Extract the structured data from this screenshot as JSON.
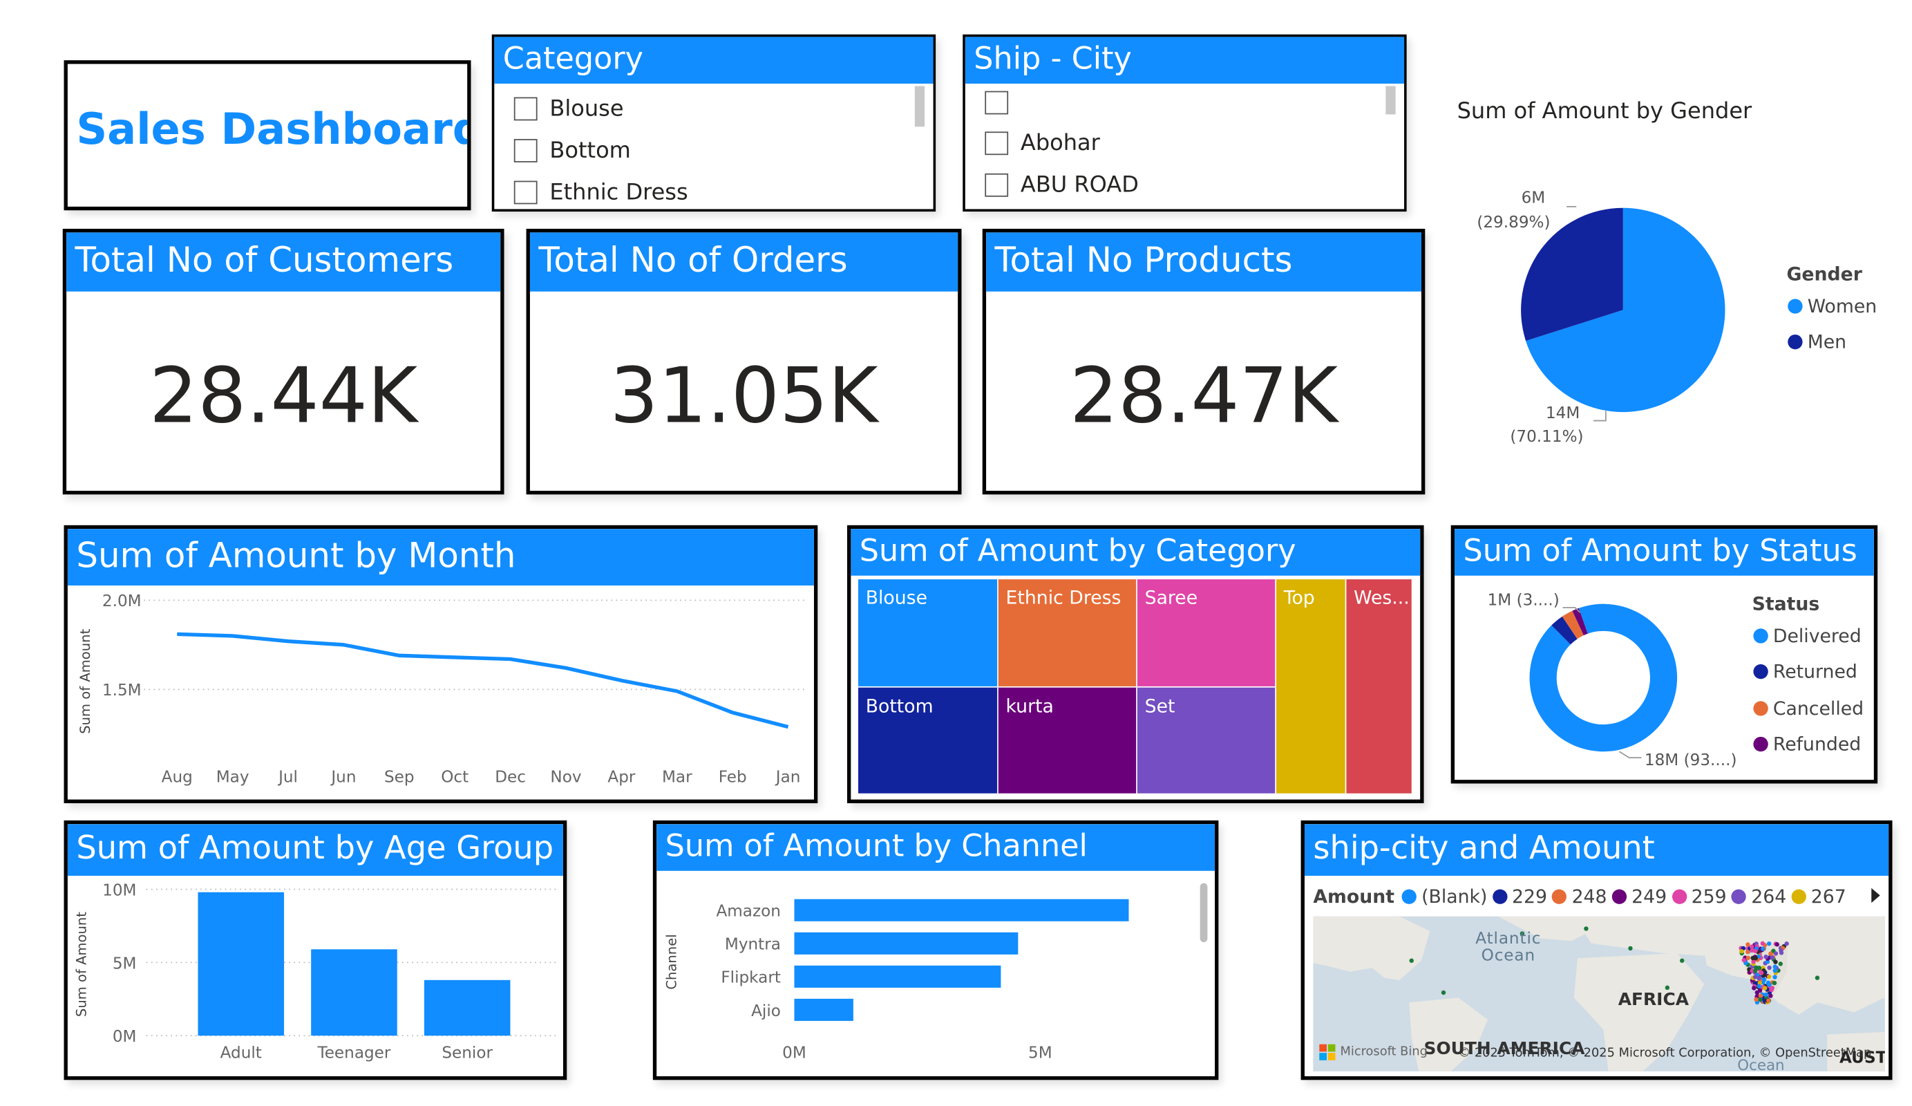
{
  "title": "Sales Dashboard",
  "slicers": {
    "category": {
      "title": "Category",
      "items": [
        "Blouse",
        "Bottom",
        "Ethnic Dress"
      ]
    },
    "ship_city": {
      "title": "Ship - City",
      "items": [
        "",
        "Abohar",
        "ABU ROAD"
      ]
    }
  },
  "kpis": [
    {
      "title": "Total No of Customers",
      "value": "28.44K"
    },
    {
      "title": "Total No of Orders",
      "value": "31.05K"
    },
    {
      "title": "Total No Products",
      "value": "28.47K"
    }
  ],
  "colors": {
    "primary": "#118DFF",
    "navy": "#12239E",
    "orange": "#E66C37",
    "purple": "#6B007B",
    "pink": "#E044A7",
    "violet": "#744EC2",
    "yellow": "#D9B300",
    "red": "#D64550"
  },
  "chart_data": [
    {
      "type": "pie",
      "title": "Sum of Amount by Gender",
      "legend_title": "Gender",
      "legend_position": "right",
      "slices": [
        {
          "label": "Women",
          "value": 14,
          "percent": 70.11,
          "value_label": "14M",
          "percent_label": "(70.11%)",
          "color": "#118DFF"
        },
        {
          "label": "Men",
          "value": 6,
          "percent": 29.89,
          "value_label": "6M",
          "percent_label": "(29.89%)",
          "color": "#12239E"
        }
      ]
    },
    {
      "type": "line",
      "title": "Sum of Amount by Month",
      "ylabel": "Sum of Amount",
      "xlabel": "",
      "categories": [
        "Aug",
        "May",
        "Jul",
        "Jun",
        "Sep",
        "Oct",
        "Dec",
        "Nov",
        "Apr",
        "Mar",
        "Feb",
        "Jan"
      ],
      "values": [
        1.81,
        1.8,
        1.77,
        1.75,
        1.69,
        1.68,
        1.67,
        1.62,
        1.55,
        1.49,
        1.37,
        1.29
      ],
      "unit_multiplier": 1000000,
      "ylim": [
        1.2,
        2.0
      ],
      "yticks": [
        1.5,
        2.0
      ],
      "ytick_labels": [
        "1.5M",
        "2.0M"
      ],
      "grid": true,
      "color": "#118DFF"
    },
    {
      "type": "treemap",
      "title": "Sum of Amount by Category",
      "cells": [
        {
          "label": "Blouse",
          "color": "#118DFF"
        },
        {
          "label": "Ethnic Dress",
          "color": "#E66C37"
        },
        {
          "label": "Saree",
          "color": "#E044A7"
        },
        {
          "label": "Top",
          "color": "#D9B300"
        },
        {
          "label": "Wes...",
          "color": "#D64550"
        },
        {
          "label": "Bottom",
          "color": "#12239E"
        },
        {
          "label": "kurta",
          "color": "#6B007B"
        },
        {
          "label": "Set",
          "color": "#744EC2"
        }
      ]
    },
    {
      "type": "donut",
      "title": "Sum of Amount by Status",
      "legend_title": "Status",
      "legend_position": "right",
      "slices": [
        {
          "label": "Delivered",
          "percent": 93,
          "color": "#118DFF"
        },
        {
          "label": "Returned",
          "percent": 3,
          "color": "#12239E"
        },
        {
          "label": "Cancelled",
          "percent": 2.5,
          "color": "#E66C37"
        },
        {
          "label": "Refunded",
          "percent": 1.5,
          "color": "#6B007B"
        }
      ],
      "data_labels": [
        "18M (93....)",
        "1M (3....)"
      ]
    },
    {
      "type": "bar",
      "title": "Sum of Amount by Age Group",
      "ylabel": "Sum of Amount",
      "xlabel": "",
      "categories": [
        "Adult",
        "Teenager",
        "Senior"
      ],
      "values": [
        9.8,
        5.9,
        3.8
      ],
      "unit_multiplier": 1000000,
      "ylim": [
        0,
        10
      ],
      "yticks": [
        0,
        5,
        10
      ],
      "ytick_labels": [
        "0M",
        "5M",
        "10M"
      ],
      "grid": true,
      "color": "#118DFF"
    },
    {
      "type": "bar",
      "orientation": "horizontal",
      "title": "Sum of Amount by Channel",
      "ylabel": "Channel",
      "xlabel": "",
      "categories": [
        "Amazon",
        "Myntra",
        "Flipkart",
        "Ajio"
      ],
      "values": [
        6.8,
        4.55,
        4.2,
        1.2
      ],
      "unit_multiplier": 1000000,
      "xlim": [
        0,
        8
      ],
      "xticks": [
        0,
        5
      ],
      "xtick_labels": [
        "0M",
        "5M"
      ],
      "color": "#118DFF"
    }
  ],
  "map": {
    "title": "ship-city and Amount",
    "legend_title": "Amount",
    "legend": [
      {
        "label": "(Blank)",
        "color": "#118DFF"
      },
      {
        "label": "229",
        "color": "#12239E"
      },
      {
        "label": "248",
        "color": "#E66C37"
      },
      {
        "label": "249",
        "color": "#6B007B"
      },
      {
        "label": "259",
        "color": "#E044A7"
      },
      {
        "label": "264",
        "color": "#744EC2"
      },
      {
        "label": "267",
        "color": "#D9B300"
      }
    ],
    "labels": {
      "ocean": "Atlantic Ocean",
      "africa": "AFRICA",
      "south_america": "SOUTH AMERICA",
      "aust": "AUST"
    },
    "ocean_lines": [
      "Atlantic",
      "Ocean"
    ],
    "attribution": "© 2025 TomTom, © 2025 Microsoft Corporation, © OpenStreetMap",
    "bing": "Microsoft Bing",
    "bottom_fragment": "Ocean"
  }
}
